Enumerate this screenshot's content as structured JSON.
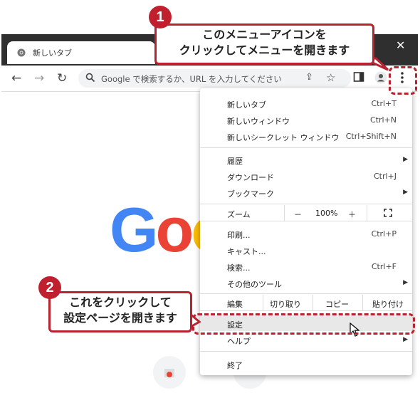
{
  "browser": {
    "tab_title": "新しいタブ",
    "close_glyph": "✕",
    "omnibox_placeholder": "Google で検索するか、URL を入力してください",
    "icons": [
      "back-icon",
      "forward-icon",
      "reload-icon",
      "search-icon",
      "share-icon",
      "star-icon",
      "sidepanel-icon",
      "profile-icon",
      "menu-dots-icon"
    ]
  },
  "page": {
    "logo_text": "Goo"
  },
  "menu": {
    "group1": [
      {
        "label": "新しいタブ",
        "shortcut": "Ctrl+T"
      },
      {
        "label": "新しいウィンドウ",
        "shortcut": "Ctrl+N"
      },
      {
        "label": "新しいシークレット ウィンドウ",
        "shortcut": "Ctrl+Shift+N"
      }
    ],
    "group2": [
      {
        "label": "履歴",
        "shortcut": ""
      },
      {
        "label": "ダウンロード",
        "shortcut": "Ctrl+J"
      },
      {
        "label": "ブックマーク",
        "shortcut": ""
      }
    ],
    "zoom": {
      "label": "ズーム",
      "minus": "－",
      "value": "100%",
      "plus": "＋"
    },
    "group3": [
      {
        "label": "印刷...",
        "shortcut": "Ctrl+P"
      },
      {
        "label": "キャスト...",
        "shortcut": ""
      },
      {
        "label": "検索...",
        "shortcut": "Ctrl+F"
      },
      {
        "label": "その他のツール",
        "shortcut": ""
      }
    ],
    "edit": {
      "label": "編集",
      "cut": "切り取り",
      "copy": "コピー",
      "paste": "貼り付け"
    },
    "group4": [
      {
        "label": "設定",
        "shortcut": ""
      },
      {
        "label": "ヘルプ",
        "shortcut": ""
      }
    ],
    "exit": "終了",
    "submenu_arrow": "▶"
  },
  "annotations": {
    "step1": {
      "number": "1",
      "text_line1": "このメニューアイコンを",
      "text_line2": "クリックしてメニューを開きます"
    },
    "step2": {
      "number": "2",
      "text_line1": "これをクリックして",
      "text_line2": "設定ページを開きます"
    }
  },
  "colors": {
    "accent_red": "#b8232f",
    "google_blue": "#4285f4",
    "google_red": "#ea4335",
    "google_yellow": "#fbbc05"
  }
}
